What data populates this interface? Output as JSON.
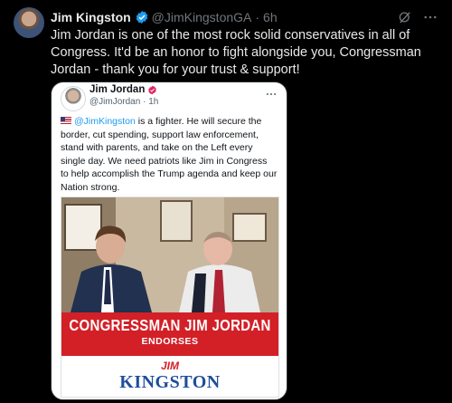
{
  "post": {
    "author_name": "Jim Kingston",
    "author_handle": "@JimKingstonGA",
    "dot": "·",
    "time": "6h",
    "text": "Jim Jordan is one of the most rock solid conservatives in all of Congress. It'd be an honor to fight alongside you, Congressman Jordan - thank you for your trust & support!",
    "icons": [
      "verified-badge-icon",
      "grok-icon",
      "more-icon"
    ]
  },
  "quoted": {
    "author_name": "Jim Jordan",
    "author_handle": "@JimJordan",
    "dot": "·",
    "time": "1h",
    "mention": "@JimKingston",
    "text": " is a fighter. He will secure the border, cut spending, support law enforcement, stand with parents, and take on the Left every single day. We need patriots like Jim in Congress to help accomplish the Trump agenda and keep our Nation strong.",
    "icons": [
      "flag-icon",
      "verified-badge-icon",
      "more-icon"
    ]
  },
  "graphic": {
    "banner_main": "CONGRESSMAN JIM JORDAN",
    "banner_sub": "ENDORSES",
    "logo_first": "JIM",
    "logo_last": "KINGSTON"
  },
  "colors": {
    "background": "#000000",
    "text": "#e7e9ea",
    "muted": "#71767b",
    "link": "#1d9bf0",
    "banner_red": "#d32027",
    "logo_blue": "#1f4e9a"
  }
}
